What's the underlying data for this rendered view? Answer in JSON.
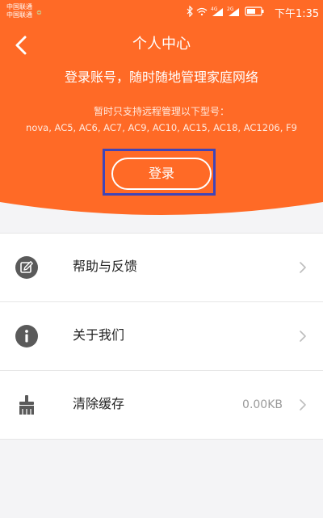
{
  "status_bar": {
    "carrier_1": "中国联通",
    "carrier_2": "中国联通",
    "time": "下午1:35",
    "network_1": "4G",
    "network_2": "2G"
  },
  "header": {
    "title": "个人中心",
    "subtitle": "登录账号，随时随地管理家庭网络",
    "note_line1": "暂时只支持远程管理以下型号：",
    "note_line2": "nova, AC5, AC6, AC7, AC9, AC10, AC15, AC18, AC1206, F9",
    "login_label": "登录",
    "accent_color": "#ff6a26"
  },
  "menu": {
    "items": [
      {
        "icon": "feedback-edit-icon",
        "label": "帮助与反馈",
        "value": ""
      },
      {
        "icon": "info-icon",
        "label": "关于我们",
        "value": ""
      },
      {
        "icon": "broom-icon",
        "label": "清除缓存",
        "value": "0.00KB"
      }
    ]
  }
}
